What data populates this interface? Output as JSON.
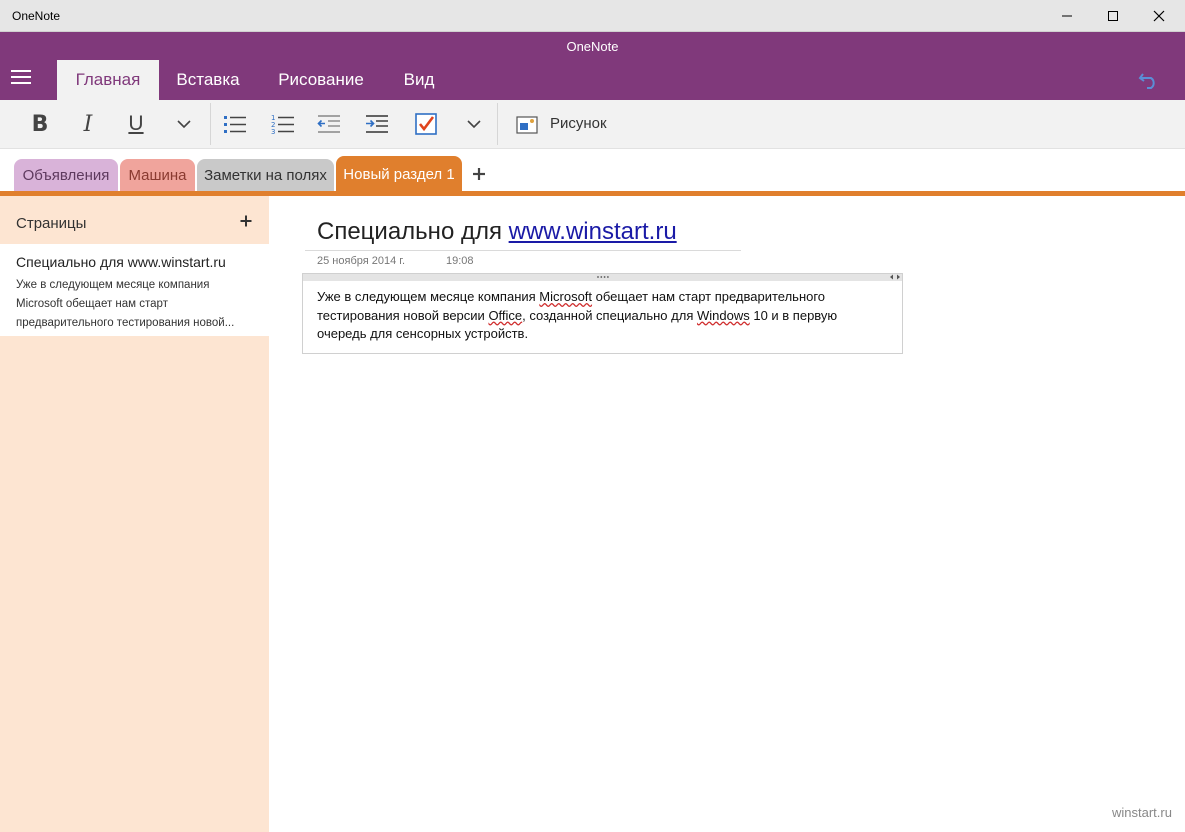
{
  "window": {
    "title": "OneNote"
  },
  "app": {
    "title": "OneNote",
    "tabs": [
      "Главная",
      "Вставка",
      "Рисование",
      "Вид"
    ]
  },
  "ribbon": {
    "bold": "B",
    "italic": "I",
    "underline": "U",
    "picture_label": "Рисунок"
  },
  "sections": [
    "Объявления",
    "Машина",
    "Заметки на полях",
    "Новый раздел 1"
  ],
  "pages_pane": {
    "header": "Страницы",
    "items": [
      {
        "title": "Специально для www.winstart.ru",
        "snippet": "Уже в следующем месяце компания Microsoft обещает нам старт предварительного тестирования новой..."
      }
    ]
  },
  "note": {
    "title_prefix": "Специально для ",
    "title_link": "www.winstart.ru",
    "date": "25 ноября 2014 г.",
    "time": "19:08",
    "body": {
      "p1": "Уже в следующем месяце компания ",
      "w1": "Microsoft",
      "p2": " обещает нам старт предварительного тестирования новой версии ",
      "w2": "Office",
      "p3": ", созданной специально для ",
      "w3": "Windows",
      "p4": " 10 и в первую очередь для сенсорных устройств."
    }
  },
  "watermark": "winstart.ru",
  "colors": {
    "app_purple": "#80397b",
    "section_orange": "#e07f2d",
    "pages_bg": "#fde5d2",
    "link_blue": "#1a1aa6"
  }
}
